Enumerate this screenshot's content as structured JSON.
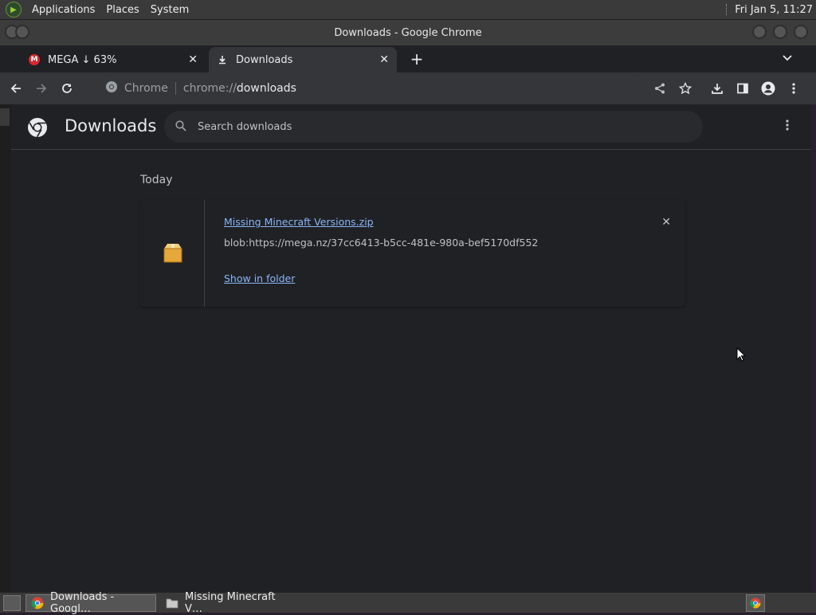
{
  "desktop": {
    "menus": [
      "Applications",
      "Places",
      "System"
    ],
    "clock": "Fri Jan  5, 11:27"
  },
  "window": {
    "title": "Downloads - Google Chrome"
  },
  "tabs": [
    {
      "label": "MEGA ↓ 63%",
      "favicon": "mega-icon",
      "active": false
    },
    {
      "label": "Downloads",
      "favicon": "download-icon",
      "active": true
    }
  ],
  "omnibox": {
    "site_chip": "Chrome",
    "scheme": "chrome://",
    "host": "downloads"
  },
  "downloads_page": {
    "title": "Downloads",
    "search_placeholder": "Search downloads",
    "date_header": "Today",
    "items": [
      {
        "file_name": "Missing Minecraft Versions.zip",
        "url": "blob:https://mega.nz/37cc6413-b5cc-481e-980a-bef5170df552",
        "action": "Show in folder",
        "icon": "zip-archive-icon"
      }
    ]
  },
  "taskbar": {
    "tasks": [
      {
        "label": "Downloads - Googl…",
        "icon": "chrome-icon",
        "active": true
      },
      {
        "label": "Missing Minecraft V…",
        "icon": "folder-icon",
        "active": false
      }
    ]
  },
  "colors": {
    "link": "#8ab4f8",
    "page_bg": "#202124",
    "toolbar_bg": "#35363a",
    "mega_red": "#d9272e"
  }
}
